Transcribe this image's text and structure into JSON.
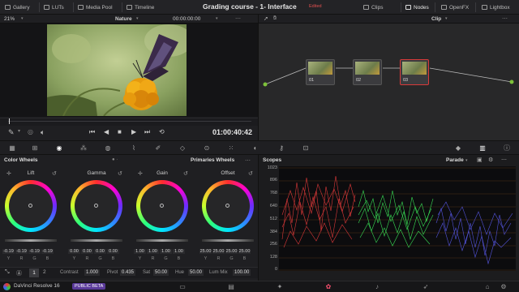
{
  "topbar": {
    "tabs": [
      {
        "label": "Gallery",
        "icon": "gallery-icon"
      },
      {
        "label": "LUTs",
        "icon": "luts-icon"
      },
      {
        "label": "Media Pool",
        "icon": "media-pool-icon"
      },
      {
        "label": "Timeline",
        "icon": "timeline-icon"
      }
    ],
    "title": "Grading course - 1- Interface",
    "edited": "Edited",
    "right_tabs": [
      {
        "label": "Clips",
        "icon": "clips-icon"
      },
      {
        "label": "Nodes",
        "icon": "nodes-icon"
      },
      {
        "label": "OpenFX",
        "icon": "openfx-icon"
      },
      {
        "label": "Lightbox",
        "icon": "lightbox-icon"
      }
    ]
  },
  "viewer": {
    "zoom": "21%",
    "clip_name": "Nature",
    "timecode_top": "00:00:00:00",
    "timecode": "01:00:40:42"
  },
  "nodes": {
    "mode": "Clip",
    "items": [
      {
        "label": "01"
      },
      {
        "label": "02"
      },
      {
        "label": "03"
      }
    ]
  },
  "color_wheels": {
    "title": "Color Wheels",
    "mode": "Primaries Wheels",
    "wheels": [
      {
        "name": "Lift",
        "values": [
          "-0.19",
          "-0.19",
          "-0.19",
          "-0.19"
        ]
      },
      {
        "name": "Gamma",
        "values": [
          "0.00",
          "0.00",
          "0.00",
          "0.00"
        ]
      },
      {
        "name": "Gain",
        "values": [
          "1.00",
          "1.00",
          "1.00",
          "1.00"
        ]
      },
      {
        "name": "Offset",
        "values": [
          "25.00",
          "25.00",
          "25.00",
          "25.00"
        ]
      }
    ],
    "channel_labels": [
      "Y",
      "R",
      "G",
      "B"
    ],
    "page_1": "1",
    "page_2": "2",
    "contrast_label": "Contrast",
    "contrast": "1.000",
    "pivot_label": "Pivot",
    "pivot": "0.435",
    "sat_label": "Sat",
    "sat": "50.00",
    "hue_label": "Hue",
    "hue": "50.00",
    "lummix_label": "Lum Mix",
    "lummix": "100.00"
  },
  "scopes": {
    "title": "Scopes",
    "mode": "Parade",
    "ticks": [
      "1023",
      "896",
      "768",
      "640",
      "512",
      "384",
      "256",
      "128",
      "0"
    ],
    "colors": {
      "red": "#ff4040",
      "green": "#40ff60",
      "blue": "#6060ff"
    }
  },
  "footer": {
    "app": "DaVinci Resolve 16",
    "badge": "PUBLIC BETA"
  }
}
